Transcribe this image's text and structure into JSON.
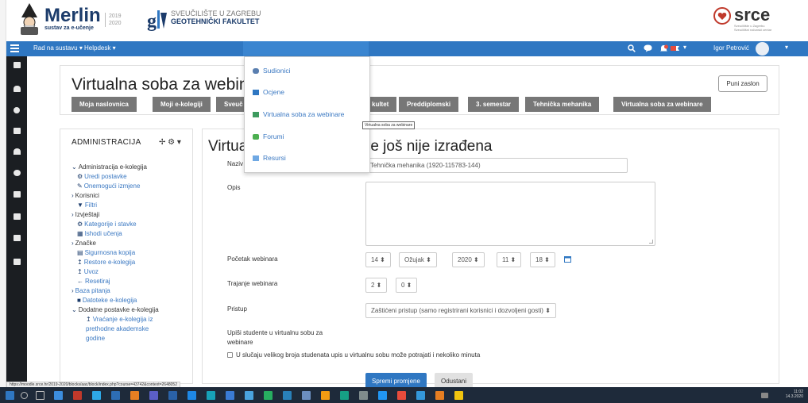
{
  "header": {
    "merlin_brand": "Merlin",
    "merlin_tagline": "sustav za e-učenje",
    "merlin_years": [
      "2019",
      "2020"
    ],
    "university": "SVEUČILIŠTE U ZAGREBU",
    "faculty": "GEOTEHNIČKI FAKULTET",
    "srce_brand": "srce",
    "srce_sub": [
      "Sveučilište u Zagrebu",
      "Sveučilišni računski centar"
    ]
  },
  "navbar": {
    "menu1": "Rad na sustavu ▾",
    "menu2": "Helpdesk ▾",
    "user_name": "Igor Petrović"
  },
  "page": {
    "title": "Virtualna soba za webinare",
    "fullscreen": "Puni zaslon",
    "breadcrumbs": [
      "Moja naslovnica",
      "Moji e-kolegiji",
      "Sveuč",
      "kultet",
      "Preddiplomski",
      "3. semestar",
      "Tehnička mehanika",
      "Virtualna soba za webinare"
    ]
  },
  "dropdown": {
    "items": [
      "Sudionici",
      "Ocjene",
      "Virtualna soba za webinare",
      "Forumi",
      "Resursi"
    ],
    "tooltip": "Virtualna soba za webinare"
  },
  "admin": {
    "title": "ADMINISTRACIJA",
    "tree": [
      "Administracija e-kolegija",
      "Uredi postavke",
      "Onemogući izmjene",
      "Korisnici",
      "Filtri",
      "Izvještaji",
      "Kategorije i stavke",
      "Ishodi učenja",
      "Značke",
      "Sigurnosna kopija",
      "Restore e-kolegija",
      "Uvoz",
      "Resetiraj",
      "Baza pitanja",
      "Datoteke e-kolegija",
      "Dodatne postavke e-kolegija",
      "Vraćanje e-kolegija iz",
      "prethodne akademske",
      "godine"
    ]
  },
  "content": {
    "title_visible": "re još nije izrađena",
    "title_prefix": "Virtua",
    "fields": {
      "name_label": "Naziv",
      "name_value": "Tehnička mehanika (1920-115783-144)",
      "desc_label": "Opis",
      "start_label": "Početak webinara",
      "start_day": "14",
      "start_month": "Ožujak",
      "start_year": "2020",
      "start_hour": "11",
      "start_minute": "18",
      "duration_label": "Trajanje webinara",
      "duration_hours": "2",
      "duration_minutes": "0",
      "access_label": "Pristup",
      "access_value": "Zaštićeni pristup (samo registrirani korisnici i dozvoljeni gosti)",
      "enroll_label_1": "Upiši studente u virtualnu sobu za",
      "enroll_label_2": "webinare",
      "enroll_note": "U slučaju velikog broja studenata upis u virtualnu sobu može potrajati i nekoliko minuta"
    },
    "save_button": "Spremi promjene",
    "cancel_button": "Odustani"
  },
  "status_url": "https://moodle.srce.hr/2019-2020/blocks/aac/block/index.php?course=43742&context=2648052",
  "taskbar": {
    "time": "11:02",
    "date": "14.3.2020"
  }
}
